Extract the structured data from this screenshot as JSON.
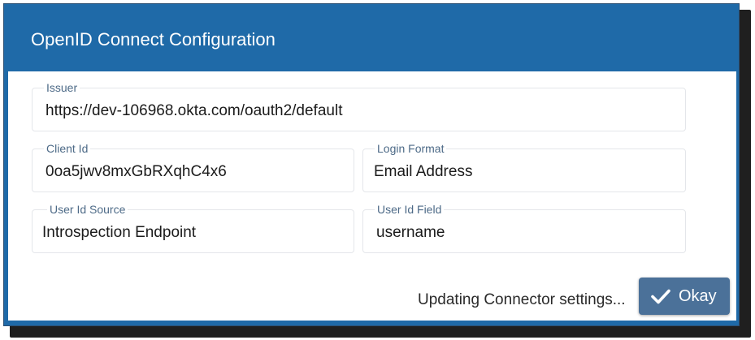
{
  "dialog": {
    "title": "OpenID Connect Configuration"
  },
  "fields": {
    "issuer": {
      "label": "Issuer",
      "value": "https://dev-106968.okta.com/oauth2/default"
    },
    "client_id": {
      "label": "Client Id",
      "value": "0oa5jwv8mxGbRXqhC4x6"
    },
    "login_format": {
      "label": "Login Format",
      "value": "Email Address"
    },
    "user_id_source": {
      "label": "User Id Source",
      "value": "Introspection Endpoint"
    },
    "user_id_field": {
      "label": "User Id Field",
      "value": "username"
    }
  },
  "footer": {
    "status_text": "Updating Connector settings...",
    "okay_label": "Okay",
    "okay_icon": "checkmark-icon"
  },
  "colors": {
    "header_bg": "#1f6aa8",
    "button_bg": "#4b7199",
    "label_text": "#4d6a87"
  }
}
